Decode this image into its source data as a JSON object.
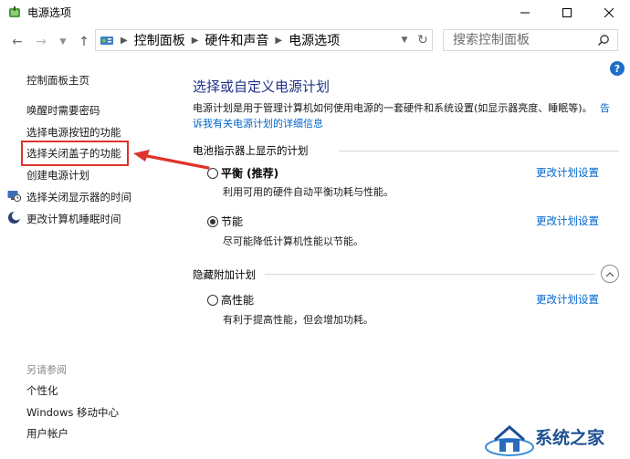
{
  "window": {
    "title": "电源选项",
    "icon": "power-options-icon"
  },
  "navigation": {
    "breadcrumb": [
      "控制面板",
      "硬件和声音",
      "电源选项"
    ],
    "search_placeholder": "搜索控制面板"
  },
  "left_pane": {
    "home_link": "控制面板主页",
    "tasks": [
      {
        "label": "唤醒时需要密码",
        "icon": null
      },
      {
        "label": "选择电源按钮的功能",
        "icon": null
      },
      {
        "label": "选择关闭盖子的功能",
        "icon": null,
        "highlighted": true
      },
      {
        "label": "创建电源计划",
        "icon": null
      },
      {
        "label": "选择关闭显示器的时间",
        "icon": "monitor-clock-icon"
      },
      {
        "label": "更改计算机睡眠时间",
        "icon": "moon-icon"
      }
    ],
    "see_also": {
      "title": "另请参阅",
      "links": [
        "个性化",
        "Windows 移动中心",
        "用户帐户"
      ]
    }
  },
  "main": {
    "heading": "选择或自定义电源计划",
    "description": "电源计划是用于管理计算机如何使用电源的一套硬件和系统设置(如显示器亮度、睡眠等)。",
    "description_link_head": "告",
    "description_link": "诉我有关电源计划的详细信息",
    "battery_section": {
      "title": "电池指示器上显示的计划",
      "plans": [
        {
          "name": "平衡 (推荐)",
          "description": "利用可用的硬件自动平衡功耗与性能。",
          "selected": false,
          "change_link": "更改计划设置"
        },
        {
          "name": "节能",
          "description": "尽可能降低计算机性能以节能。",
          "selected": true,
          "change_link": "更改计划设置"
        }
      ]
    },
    "hidden_section": {
      "title": "隐藏附加计划",
      "plans": [
        {
          "name": "高性能",
          "description": "有利于提高性能，但会增加功耗。",
          "selected": false,
          "change_link": "更改计划设置"
        }
      ]
    }
  },
  "watermark": {
    "text": "系统之家"
  },
  "colors": {
    "heading": "#1e3287",
    "link": "#0066cc",
    "highlight_border": "#e0322c"
  }
}
